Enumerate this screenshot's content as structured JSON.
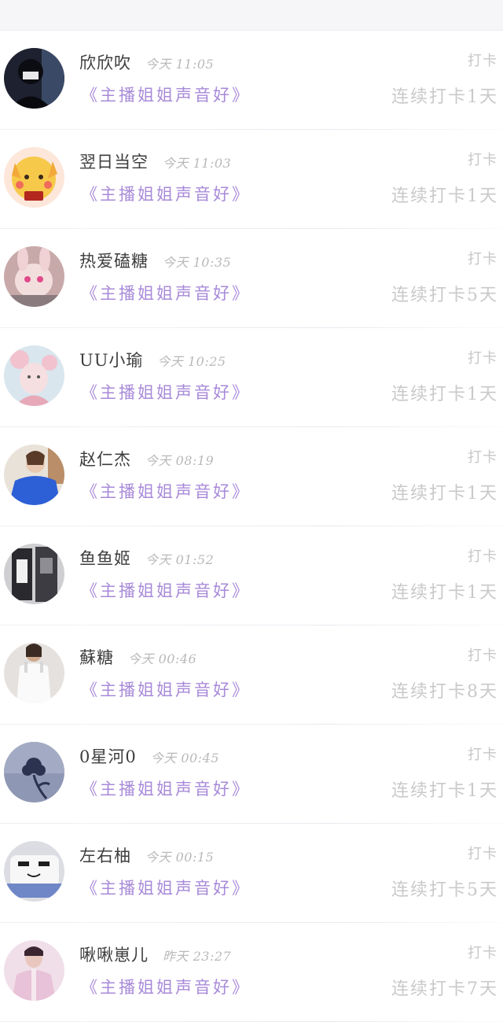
{
  "checkin_label": "打卡",
  "items": [
    {
      "name": "欣欣吹",
      "time": "今天 11:05",
      "title": "《主播姐姐声音好》",
      "streak": "连续打卡1天",
      "avatar_icon": "user-avatar-dark-masked"
    },
    {
      "name": "翌日当空",
      "time": "今天 11:03",
      "title": "《主播姐姐声音好》",
      "streak": "连续打卡1天",
      "avatar_icon": "user-avatar-yellow-cartoon"
    },
    {
      "name": "热爱磕糖",
      "time": "今天 10:35",
      "title": "《主播姐姐声音好》",
      "streak": "连续打卡5天",
      "avatar_icon": "user-avatar-pink-bunny"
    },
    {
      "name": "UU小瑜",
      "time": "今天 10:25",
      "title": "《主播姐姐声音好》",
      "streak": "连续打卡1天",
      "avatar_icon": "user-avatar-pink-anime"
    },
    {
      "name": "赵仁杰",
      "time": "今天 08:19",
      "title": "《主播姐姐声音好》",
      "streak": "连续打卡1天",
      "avatar_icon": "user-avatar-blue-jacket"
    },
    {
      "name": "鱼鱼姬",
      "time": "今天 01:52",
      "title": "《主播姐姐声音好》",
      "streak": "连续打卡1天",
      "avatar_icon": "user-avatar-dark-clothes"
    },
    {
      "name": "蘇糖",
      "time": "今天 00:46",
      "title": "《主播姐姐声音好》",
      "streak": "连续打卡8天",
      "avatar_icon": "user-avatar-white-dress"
    },
    {
      "name": "0星河0",
      "time": "今天 00:45",
      "title": "《主播姐姐声音好》",
      "streak": "连续打卡1天",
      "avatar_icon": "user-avatar-blue-rose"
    },
    {
      "name": "左右柚",
      "time": "今天 00:15",
      "title": "《主播姐姐声音好》",
      "streak": "连续打卡5天",
      "avatar_icon": "user-avatar-white-cake"
    },
    {
      "name": "啾啾崽儿",
      "time": "昨天 23:27",
      "title": "《主播姐姐声音好》",
      "streak": "连续打卡7天",
      "avatar_icon": "user-avatar-pink-portrait"
    }
  ]
}
